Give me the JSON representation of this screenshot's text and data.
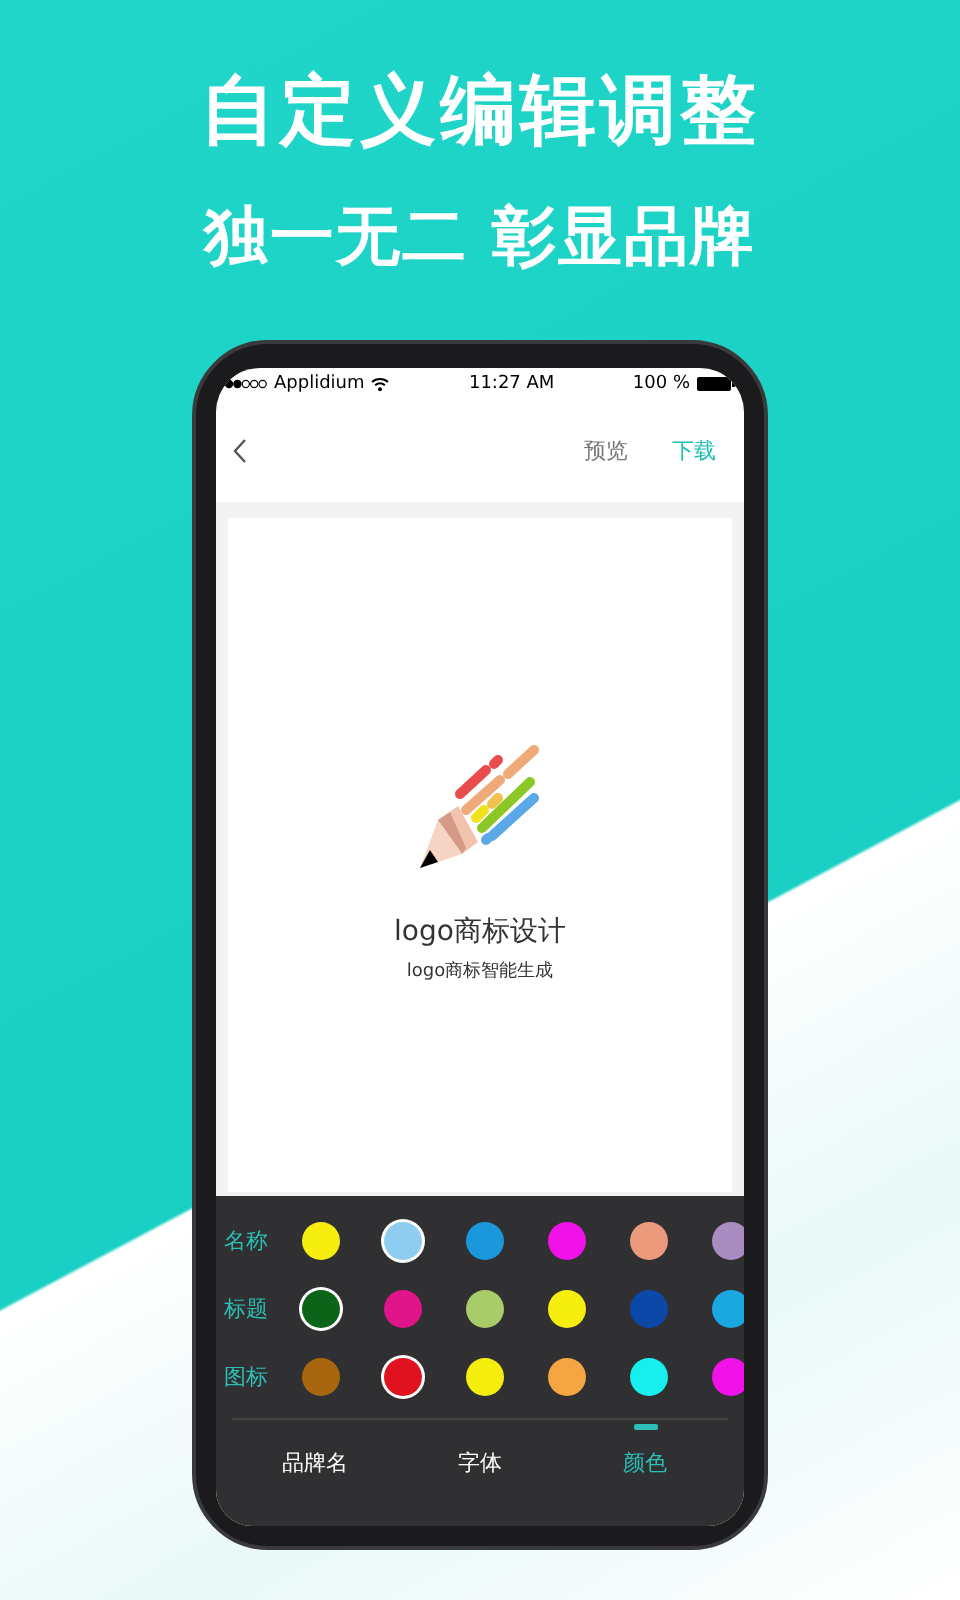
{
  "headline": "自定义编辑调整",
  "subheadline": "独一无二 彰显品牌",
  "status_bar": {
    "carrier": "Applidium",
    "time": "11:27 AM",
    "battery": "100 %"
  },
  "nav": {
    "actions": [
      {
        "label": "预览",
        "kind": "plain"
      },
      {
        "label": "下载",
        "kind": "accent"
      }
    ]
  },
  "preview": {
    "brand_name": "logo商标设计",
    "slogan": "logo商标智能生成"
  },
  "color_rows": [
    {
      "label": "名称",
      "swatches": [
        {
          "color": "#f5ee0f",
          "selected": false
        },
        {
          "color": "#8ecdf0",
          "selected": true
        },
        {
          "color": "#1b98dc",
          "selected": false
        },
        {
          "color": "#f012e8",
          "selected": false
        },
        {
          "color": "#ec9a7c",
          "selected": false
        },
        {
          "color": "#a98cc2",
          "selected": false
        }
      ]
    },
    {
      "label": "标题",
      "swatches": [
        {
          "color": "#0b6418",
          "selected": true
        },
        {
          "color": "#e0158a",
          "selected": false
        },
        {
          "color": "#a9cc6b",
          "selected": false
        },
        {
          "color": "#f5ee0f",
          "selected": false
        },
        {
          "color": "#0b48a8",
          "selected": false
        },
        {
          "color": "#19a8e0",
          "selected": false
        }
      ]
    },
    {
      "label": "图标",
      "swatches": [
        {
          "color": "#a8670f",
          "selected": false
        },
        {
          "color": "#e0121f",
          "selected": true
        },
        {
          "color": "#f5ee0f",
          "selected": false
        },
        {
          "color": "#f5a542",
          "selected": false
        },
        {
          "color": "#17eeee",
          "selected": false
        },
        {
          "color": "#f012e8",
          "selected": false
        }
      ]
    }
  ],
  "tabs": [
    {
      "label": "品牌名",
      "selected": false
    },
    {
      "label": "字体",
      "selected": false
    },
    {
      "label": "颜色",
      "selected": true
    }
  ]
}
